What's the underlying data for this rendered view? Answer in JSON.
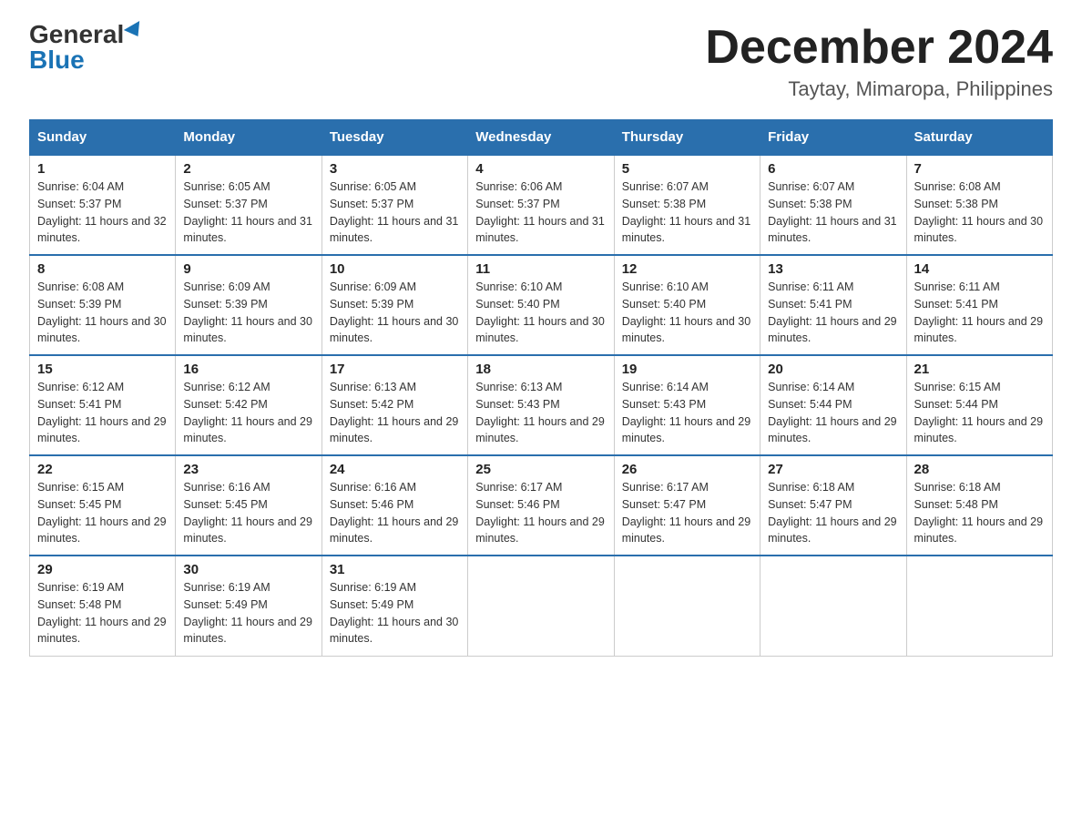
{
  "logo": {
    "general": "General",
    "blue": "Blue"
  },
  "title": "December 2024",
  "location": "Taytay, Mimaropa, Philippines",
  "headers": [
    "Sunday",
    "Monday",
    "Tuesday",
    "Wednesday",
    "Thursday",
    "Friday",
    "Saturday"
  ],
  "weeks": [
    [
      {
        "day": "1",
        "sunrise": "6:04 AM",
        "sunset": "5:37 PM",
        "daylight": "11 hours and 32 minutes."
      },
      {
        "day": "2",
        "sunrise": "6:05 AM",
        "sunset": "5:37 PM",
        "daylight": "11 hours and 31 minutes."
      },
      {
        "day": "3",
        "sunrise": "6:05 AM",
        "sunset": "5:37 PM",
        "daylight": "11 hours and 31 minutes."
      },
      {
        "day": "4",
        "sunrise": "6:06 AM",
        "sunset": "5:37 PM",
        "daylight": "11 hours and 31 minutes."
      },
      {
        "day": "5",
        "sunrise": "6:07 AM",
        "sunset": "5:38 PM",
        "daylight": "11 hours and 31 minutes."
      },
      {
        "day": "6",
        "sunrise": "6:07 AM",
        "sunset": "5:38 PM",
        "daylight": "11 hours and 31 minutes."
      },
      {
        "day": "7",
        "sunrise": "6:08 AM",
        "sunset": "5:38 PM",
        "daylight": "11 hours and 30 minutes."
      }
    ],
    [
      {
        "day": "8",
        "sunrise": "6:08 AM",
        "sunset": "5:39 PM",
        "daylight": "11 hours and 30 minutes."
      },
      {
        "day": "9",
        "sunrise": "6:09 AM",
        "sunset": "5:39 PM",
        "daylight": "11 hours and 30 minutes."
      },
      {
        "day": "10",
        "sunrise": "6:09 AM",
        "sunset": "5:39 PM",
        "daylight": "11 hours and 30 minutes."
      },
      {
        "day": "11",
        "sunrise": "6:10 AM",
        "sunset": "5:40 PM",
        "daylight": "11 hours and 30 minutes."
      },
      {
        "day": "12",
        "sunrise": "6:10 AM",
        "sunset": "5:40 PM",
        "daylight": "11 hours and 30 minutes."
      },
      {
        "day": "13",
        "sunrise": "6:11 AM",
        "sunset": "5:41 PM",
        "daylight": "11 hours and 29 minutes."
      },
      {
        "day": "14",
        "sunrise": "6:11 AM",
        "sunset": "5:41 PM",
        "daylight": "11 hours and 29 minutes."
      }
    ],
    [
      {
        "day": "15",
        "sunrise": "6:12 AM",
        "sunset": "5:41 PM",
        "daylight": "11 hours and 29 minutes."
      },
      {
        "day": "16",
        "sunrise": "6:12 AM",
        "sunset": "5:42 PM",
        "daylight": "11 hours and 29 minutes."
      },
      {
        "day": "17",
        "sunrise": "6:13 AM",
        "sunset": "5:42 PM",
        "daylight": "11 hours and 29 minutes."
      },
      {
        "day": "18",
        "sunrise": "6:13 AM",
        "sunset": "5:43 PM",
        "daylight": "11 hours and 29 minutes."
      },
      {
        "day": "19",
        "sunrise": "6:14 AM",
        "sunset": "5:43 PM",
        "daylight": "11 hours and 29 minutes."
      },
      {
        "day": "20",
        "sunrise": "6:14 AM",
        "sunset": "5:44 PM",
        "daylight": "11 hours and 29 minutes."
      },
      {
        "day": "21",
        "sunrise": "6:15 AM",
        "sunset": "5:44 PM",
        "daylight": "11 hours and 29 minutes."
      }
    ],
    [
      {
        "day": "22",
        "sunrise": "6:15 AM",
        "sunset": "5:45 PM",
        "daylight": "11 hours and 29 minutes."
      },
      {
        "day": "23",
        "sunrise": "6:16 AM",
        "sunset": "5:45 PM",
        "daylight": "11 hours and 29 minutes."
      },
      {
        "day": "24",
        "sunrise": "6:16 AM",
        "sunset": "5:46 PM",
        "daylight": "11 hours and 29 minutes."
      },
      {
        "day": "25",
        "sunrise": "6:17 AM",
        "sunset": "5:46 PM",
        "daylight": "11 hours and 29 minutes."
      },
      {
        "day": "26",
        "sunrise": "6:17 AM",
        "sunset": "5:47 PM",
        "daylight": "11 hours and 29 minutes."
      },
      {
        "day": "27",
        "sunrise": "6:18 AM",
        "sunset": "5:47 PM",
        "daylight": "11 hours and 29 minutes."
      },
      {
        "day": "28",
        "sunrise": "6:18 AM",
        "sunset": "5:48 PM",
        "daylight": "11 hours and 29 minutes."
      }
    ],
    [
      {
        "day": "29",
        "sunrise": "6:19 AM",
        "sunset": "5:48 PM",
        "daylight": "11 hours and 29 minutes."
      },
      {
        "day": "30",
        "sunrise": "6:19 AM",
        "sunset": "5:49 PM",
        "daylight": "11 hours and 29 minutes."
      },
      {
        "day": "31",
        "sunrise": "6:19 AM",
        "sunset": "5:49 PM",
        "daylight": "11 hours and 30 minutes."
      },
      null,
      null,
      null,
      null
    ]
  ]
}
